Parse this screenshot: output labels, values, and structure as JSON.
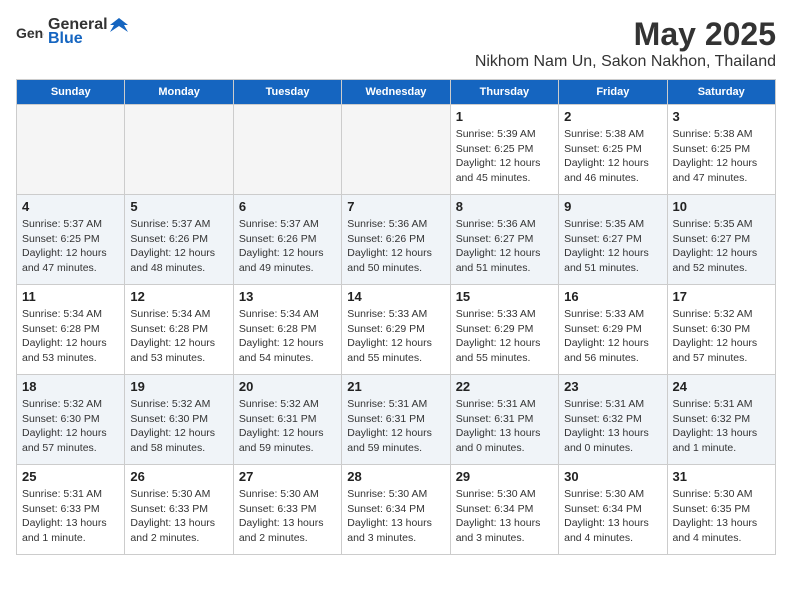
{
  "logo": {
    "text_general": "General",
    "text_blue": "Blue"
  },
  "title": "May 2025",
  "subtitle": "Nikhom Nam Un, Sakon Nakhon, Thailand",
  "headers": [
    "Sunday",
    "Monday",
    "Tuesday",
    "Wednesday",
    "Thursday",
    "Friday",
    "Saturday"
  ],
  "weeks": [
    [
      {
        "date": "",
        "info": ""
      },
      {
        "date": "",
        "info": ""
      },
      {
        "date": "",
        "info": ""
      },
      {
        "date": "",
        "info": ""
      },
      {
        "date": "1",
        "info": "Sunrise: 5:39 AM\nSunset: 6:25 PM\nDaylight: 12 hours\nand 45 minutes."
      },
      {
        "date": "2",
        "info": "Sunrise: 5:38 AM\nSunset: 6:25 PM\nDaylight: 12 hours\nand 46 minutes."
      },
      {
        "date": "3",
        "info": "Sunrise: 5:38 AM\nSunset: 6:25 PM\nDaylight: 12 hours\nand 47 minutes."
      }
    ],
    [
      {
        "date": "4",
        "info": "Sunrise: 5:37 AM\nSunset: 6:25 PM\nDaylight: 12 hours\nand 47 minutes."
      },
      {
        "date": "5",
        "info": "Sunrise: 5:37 AM\nSunset: 6:26 PM\nDaylight: 12 hours\nand 48 minutes."
      },
      {
        "date": "6",
        "info": "Sunrise: 5:37 AM\nSunset: 6:26 PM\nDaylight: 12 hours\nand 49 minutes."
      },
      {
        "date": "7",
        "info": "Sunrise: 5:36 AM\nSunset: 6:26 PM\nDaylight: 12 hours\nand 50 minutes."
      },
      {
        "date": "8",
        "info": "Sunrise: 5:36 AM\nSunset: 6:27 PM\nDaylight: 12 hours\nand 51 minutes."
      },
      {
        "date": "9",
        "info": "Sunrise: 5:35 AM\nSunset: 6:27 PM\nDaylight: 12 hours\nand 51 minutes."
      },
      {
        "date": "10",
        "info": "Sunrise: 5:35 AM\nSunset: 6:27 PM\nDaylight: 12 hours\nand 52 minutes."
      }
    ],
    [
      {
        "date": "11",
        "info": "Sunrise: 5:34 AM\nSunset: 6:28 PM\nDaylight: 12 hours\nand 53 minutes."
      },
      {
        "date": "12",
        "info": "Sunrise: 5:34 AM\nSunset: 6:28 PM\nDaylight: 12 hours\nand 53 minutes."
      },
      {
        "date": "13",
        "info": "Sunrise: 5:34 AM\nSunset: 6:28 PM\nDaylight: 12 hours\nand 54 minutes."
      },
      {
        "date": "14",
        "info": "Sunrise: 5:33 AM\nSunset: 6:29 PM\nDaylight: 12 hours\nand 55 minutes."
      },
      {
        "date": "15",
        "info": "Sunrise: 5:33 AM\nSunset: 6:29 PM\nDaylight: 12 hours\nand 55 minutes."
      },
      {
        "date": "16",
        "info": "Sunrise: 5:33 AM\nSunset: 6:29 PM\nDaylight: 12 hours\nand 56 minutes."
      },
      {
        "date": "17",
        "info": "Sunrise: 5:32 AM\nSunset: 6:30 PM\nDaylight: 12 hours\nand 57 minutes."
      }
    ],
    [
      {
        "date": "18",
        "info": "Sunrise: 5:32 AM\nSunset: 6:30 PM\nDaylight: 12 hours\nand 57 minutes."
      },
      {
        "date": "19",
        "info": "Sunrise: 5:32 AM\nSunset: 6:30 PM\nDaylight: 12 hours\nand 58 minutes."
      },
      {
        "date": "20",
        "info": "Sunrise: 5:32 AM\nSunset: 6:31 PM\nDaylight: 12 hours\nand 59 minutes."
      },
      {
        "date": "21",
        "info": "Sunrise: 5:31 AM\nSunset: 6:31 PM\nDaylight: 12 hours\nand 59 minutes."
      },
      {
        "date": "22",
        "info": "Sunrise: 5:31 AM\nSunset: 6:31 PM\nDaylight: 13 hours\nand 0 minutes."
      },
      {
        "date": "23",
        "info": "Sunrise: 5:31 AM\nSunset: 6:32 PM\nDaylight: 13 hours\nand 0 minutes."
      },
      {
        "date": "24",
        "info": "Sunrise: 5:31 AM\nSunset: 6:32 PM\nDaylight: 13 hours\nand 1 minute."
      }
    ],
    [
      {
        "date": "25",
        "info": "Sunrise: 5:31 AM\nSunset: 6:33 PM\nDaylight: 13 hours\nand 1 minute."
      },
      {
        "date": "26",
        "info": "Sunrise: 5:30 AM\nSunset: 6:33 PM\nDaylight: 13 hours\nand 2 minutes."
      },
      {
        "date": "27",
        "info": "Sunrise: 5:30 AM\nSunset: 6:33 PM\nDaylight: 13 hours\nand 2 minutes."
      },
      {
        "date": "28",
        "info": "Sunrise: 5:30 AM\nSunset: 6:34 PM\nDaylight: 13 hours\nand 3 minutes."
      },
      {
        "date": "29",
        "info": "Sunrise: 5:30 AM\nSunset: 6:34 PM\nDaylight: 13 hours\nand 3 minutes."
      },
      {
        "date": "30",
        "info": "Sunrise: 5:30 AM\nSunset: 6:34 PM\nDaylight: 13 hours\nand 4 minutes."
      },
      {
        "date": "31",
        "info": "Sunrise: 5:30 AM\nSunset: 6:35 PM\nDaylight: 13 hours\nand 4 minutes."
      }
    ]
  ]
}
